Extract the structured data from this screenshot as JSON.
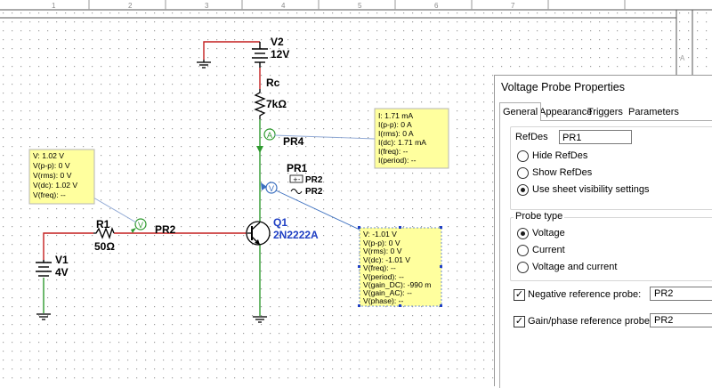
{
  "ruler": {
    "labels": [
      "1",
      "2",
      "3",
      "4",
      "5",
      "6",
      "7"
    ]
  },
  "schematic": {
    "v2": {
      "name": "V2",
      "value": "12V"
    },
    "rc": {
      "name": "Rc",
      "value": "7kΩ"
    },
    "pr4": {
      "name": "PR4",
      "glyph": "A"
    },
    "pr1": {
      "name": "PR1",
      "neg_ref": "PR2",
      "gain_ref": "PR2",
      "glyph": "V"
    },
    "r1": {
      "name": "R1",
      "value": "50Ω"
    },
    "pr2": {
      "name": "PR2",
      "glyph": "V"
    },
    "q1": {
      "name": "Q1",
      "model": "2N2222A"
    },
    "v1": {
      "name": "V1",
      "value": "4V"
    },
    "colors": {
      "wire_red": "#c41e1e",
      "wire_green": "#2f9a2f",
      "probe_box": "#ffff9e",
      "label_blue": "#1f3fc4"
    }
  },
  "probe_boxes": {
    "pr2_box": [
      "V: 1.02 V",
      "V(p-p): 0 V",
      "V(rms): 0 V",
      "V(dc): 1.02 V",
      "V(freq): --"
    ],
    "pr4_box": [
      "I: 1.71 mA",
      "I(p-p): 0 A",
      "I(rms): 0 A",
      "I(dc): 1.71 mA",
      "I(freq): --",
      "I(period): --"
    ],
    "pr1_box": [
      "V: -1.01 V",
      "V(p-p): 0 V",
      "V(rms): 0 V",
      "V(dc): -1.01 V",
      "V(freq): --",
      "V(period): --",
      "V(gain_DC): -990 m",
      "V(gain_AC): --",
      "V(phase): --"
    ]
  },
  "dialog": {
    "title": "Voltage Probe Properties",
    "tabs": [
      "General",
      "Appearance",
      "Triggers",
      "Parameters"
    ],
    "refdes_label": "RefDes",
    "refdes_value": "PR1",
    "radio_refdes": [
      "Hide RefDes",
      "Show RefDes",
      "Use sheet visibility settings"
    ],
    "probe_type_title": "Probe type",
    "radio_type": [
      "Voltage",
      "Current",
      "Voltage and current"
    ],
    "neg_ref_label": "Negative reference probe:",
    "neg_ref_value": "PR2",
    "gain_ref_label": "Gain/phase reference probe:",
    "gain_ref_value": "PR2"
  }
}
